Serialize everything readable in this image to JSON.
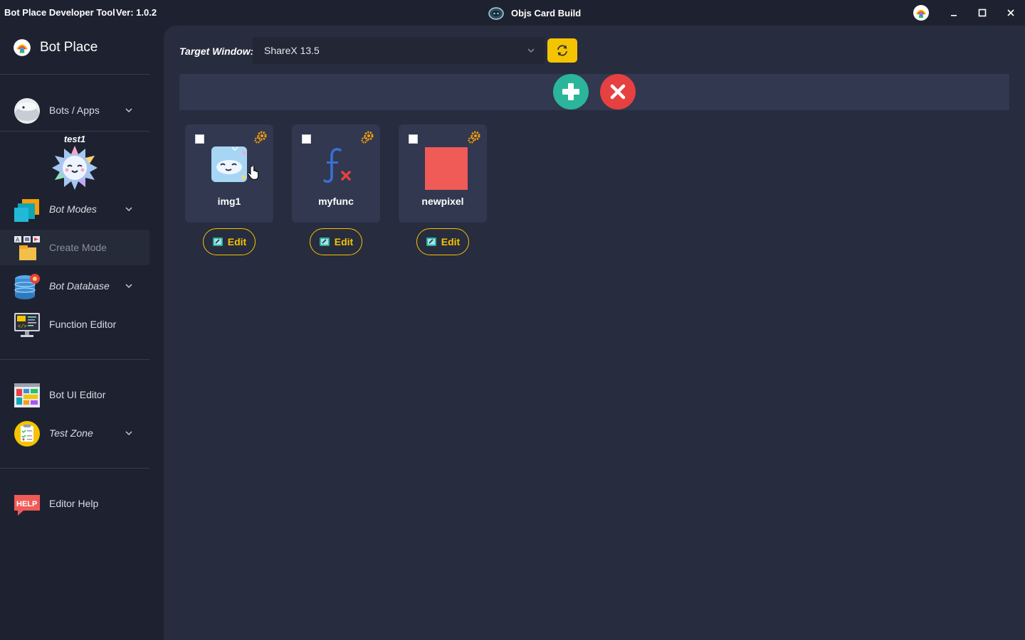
{
  "titlebar": {
    "app_title": "Bot Place Developer Tool",
    "version": "Ver: 1.0.2",
    "window_title": "Objs Card Build",
    "icons": [
      "bot-head-icon",
      "botplace-logo-icon",
      "minimize-icon",
      "maximize-icon",
      "close-icon"
    ]
  },
  "sidebar": {
    "brand": "Bot Place",
    "bots_apps": "Bots / Apps",
    "bot_user": "test1",
    "items": [
      {
        "label": "Bot Modes",
        "italic": true,
        "chevron": true,
        "icon": "modes-icon"
      },
      {
        "label": "Create Mode",
        "italic": false,
        "chevron": false,
        "icon": "create-mode-icon",
        "active": true
      },
      {
        "label": "Bot Database",
        "italic": true,
        "chevron": true,
        "icon": "database-icon"
      },
      {
        "label": "Function Editor",
        "italic": false,
        "chevron": false,
        "icon": "function-editor-icon"
      },
      {
        "label": "Bot UI Editor",
        "italic": false,
        "chevron": false,
        "icon": "ui-editor-icon"
      },
      {
        "label": "Test Zone",
        "italic": true,
        "chevron": true,
        "icon": "test-zone-icon"
      },
      {
        "label": "Editor Help",
        "italic": false,
        "chevron": false,
        "icon": "help-icon"
      }
    ]
  },
  "main": {
    "target_label": "Target Window:",
    "target_value": "ShareX 13.5",
    "cards": [
      {
        "name": "img1",
        "edit": "Edit",
        "thumb": "image-thumb"
      },
      {
        "name": "myfunc",
        "edit": "Edit",
        "thumb": "function-thumb"
      },
      {
        "name": "newpixel",
        "edit": "Edit",
        "thumb": "pixel-thumb"
      }
    ]
  },
  "colors": {
    "accent": "#f5c400",
    "add": "#2bb59a",
    "remove": "#e74040",
    "pixel": "#f05a57"
  }
}
